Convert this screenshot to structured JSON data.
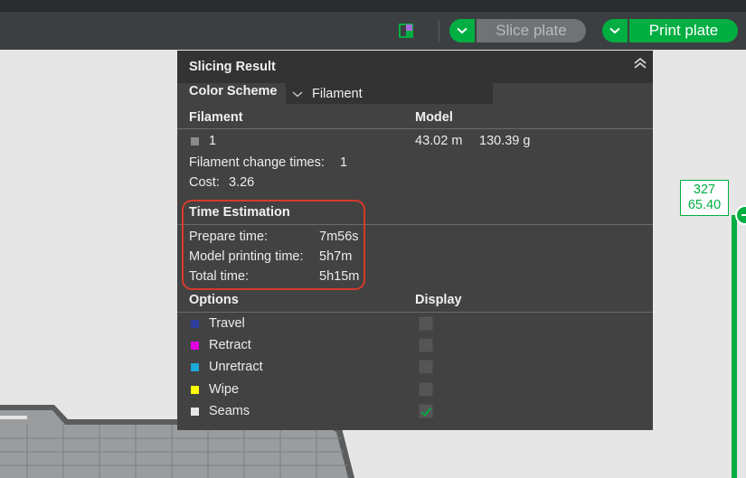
{
  "toolbar": {
    "layout_icon": "layout-icon",
    "slice_label": "Slice plate",
    "print_label": "Print plate",
    "accent_color": "#00ae42"
  },
  "panel": {
    "title": "Slicing Result",
    "collapse_icon": "double-chevron-up-icon",
    "color_scheme_label": "Color Scheme",
    "color_scheme_value": "Filament",
    "filament_header": "Filament",
    "model_header": "Model",
    "filament_row": {
      "id": "1",
      "length": "43.02 m",
      "weight": "130.39 g",
      "color": "#8a8a8a"
    },
    "filament_change_label": "Filament change times:",
    "filament_change_value": "1",
    "cost_label": "Cost:",
    "cost_value": "3.26",
    "time_estimation": {
      "header": "Time Estimation",
      "rows": [
        {
          "label": "Prepare time:",
          "value": "7m56s"
        },
        {
          "label": "Model printing time:",
          "value": "5h7m"
        },
        {
          "label": "Total time:",
          "value": "5h15m"
        }
      ]
    },
    "options_header": "Options",
    "display_header": "Display",
    "options": [
      {
        "label": "Travel",
        "color": "#2c3f9e",
        "checked": false
      },
      {
        "label": "Retract",
        "color": "#e000e0",
        "checked": false
      },
      {
        "label": "Unretract",
        "color": "#1aa8d8",
        "checked": false
      },
      {
        "label": "Wipe",
        "color": "#ffff00",
        "checked": false
      },
      {
        "label": "Seams",
        "color": "#e6e6e6",
        "checked": true
      }
    ]
  },
  "layer_slider": {
    "layer": "327",
    "height": "65.40"
  }
}
